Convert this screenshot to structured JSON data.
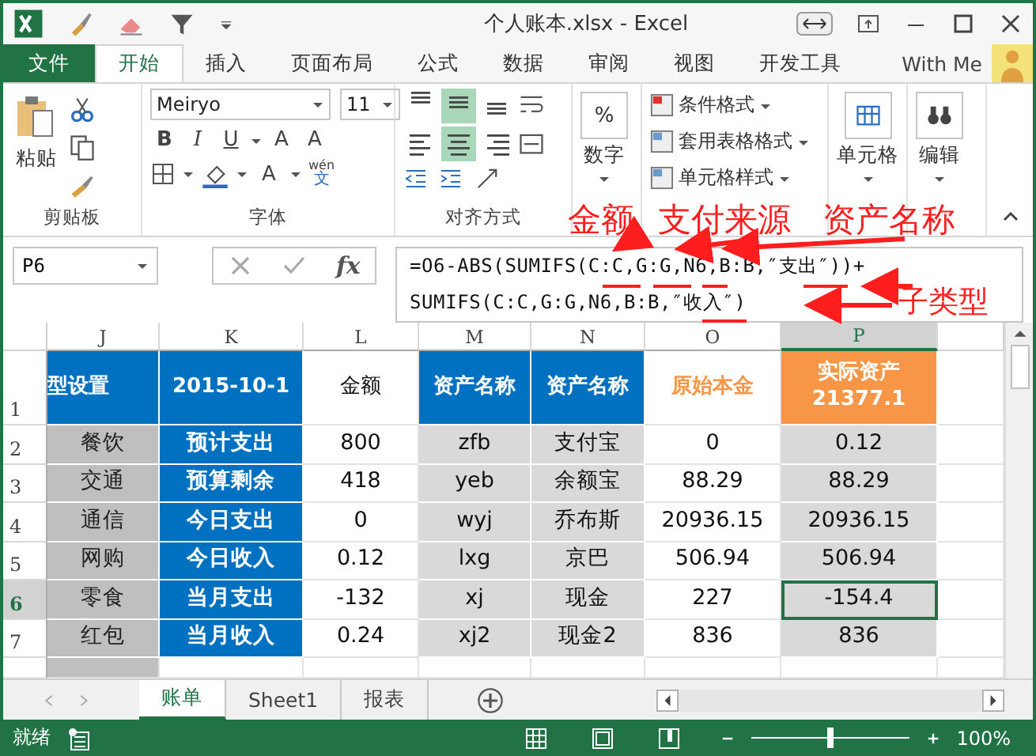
{
  "title_bar": {
    "title": "个人账本.xlsx - Excel"
  },
  "ribbon_tabs": [
    {
      "label": "文件",
      "kind": "file",
      "selected": false
    },
    {
      "label": "开始",
      "kind": "tab",
      "selected": true
    },
    {
      "label": "插入",
      "kind": "tab",
      "selected": false
    },
    {
      "label": "页面布局",
      "kind": "tab",
      "selected": false
    },
    {
      "label": "公式",
      "kind": "tab",
      "selected": false
    },
    {
      "label": "数据",
      "kind": "tab",
      "selected": false
    },
    {
      "label": "审阅",
      "kind": "tab",
      "selected": false
    },
    {
      "label": "视图",
      "kind": "tab",
      "selected": false
    },
    {
      "label": "开发工具",
      "kind": "tab",
      "selected": false
    }
  ],
  "account": {
    "name": "With Me"
  },
  "ribbon": {
    "clipboard": {
      "paste": "粘贴",
      "label": "剪贴板"
    },
    "font": {
      "font_name": "Meiryo",
      "font_size": "11",
      "bold": "B",
      "italic": "I",
      "underline": "U",
      "grow": "A",
      "shrink": "A",
      "font_color": "A",
      "phonetic_top": "wén",
      "phonetic_bottom": "文",
      "label": "字体"
    },
    "alignment": {
      "label": "对齐方式",
      "buttons": [
        {
          "kind": "top",
          "selected": false
        },
        {
          "kind": "middle",
          "selected": true
        },
        {
          "kind": "bottom",
          "selected": false
        },
        {
          "kind": "left",
          "selected": false
        },
        {
          "kind": "center",
          "selected": true
        },
        {
          "kind": "right",
          "selected": false
        }
      ]
    },
    "number": {
      "symbol": "%",
      "label": "数字"
    },
    "styles": {
      "items": [
        "条件格式",
        "套用表格格式",
        "单元格样式"
      ]
    },
    "cells": {
      "label": "单元格"
    },
    "editing": {
      "label": "编辑"
    }
  },
  "formula_bar": {
    "name_box": "P6",
    "fx": "fx",
    "formula_lines": [
      "=O6-ABS(SUMIFS(C:C,G:G,N6,B:B,″支出″))+",
      "SUMIFS(C:C,G:G,N6,B:B,″收入″)"
    ]
  },
  "annotations": [
    "金额",
    "支付来源",
    "资产名称",
    "子类型"
  ],
  "sheet": {
    "columns": [
      {
        "letter": "J",
        "kind": "grey",
        "selected": false
      },
      {
        "letter": "K",
        "kind": "blue",
        "selected": false
      },
      {
        "letter": "L",
        "kind": "plain",
        "selected": false
      },
      {
        "letter": "M",
        "kind": "light",
        "selected": false
      },
      {
        "letter": "N",
        "kind": "light",
        "selected": false
      },
      {
        "letter": "O",
        "kind": "plain",
        "selected": false
      },
      {
        "letter": "P",
        "kind": "light",
        "selected": true
      }
    ],
    "header_row": {
      "number": "1",
      "selected": false,
      "cells": [
        {
          "text": "型设置",
          "kind": "blue"
        },
        {
          "text": "2015-10-1",
          "kind": "blue"
        },
        {
          "text": "金额",
          "kind": "plain"
        },
        {
          "text": "资产名称",
          "kind": "blue"
        },
        {
          "text": "资产名称",
          "kind": "blue"
        },
        {
          "text": "原始本金",
          "kind": "orange_text"
        },
        {
          "text": "实际资产\n21377.1",
          "kind": "orange"
        }
      ]
    },
    "rows": [
      {
        "number": "2",
        "selected": false,
        "cells": [
          "餐饮",
          "预计支出",
          "800",
          "zfb",
          "支付宝",
          "0",
          "0.12"
        ]
      },
      {
        "number": "3",
        "selected": false,
        "cells": [
          "交通",
          "预算剩余",
          "418",
          "yeb",
          "余额宝",
          "88.29",
          "88.29"
        ]
      },
      {
        "number": "4",
        "selected": false,
        "cells": [
          "通信",
          "今日支出",
          "0",
          "wyj",
          "乔布斯",
          "20936.15",
          "20936.15"
        ]
      },
      {
        "number": "5",
        "selected": false,
        "cells": [
          "网购",
          "今日收入",
          "0.12",
          "lxg",
          "京巴",
          "506.94",
          "506.94"
        ]
      },
      {
        "number": "6",
        "selected": true,
        "cells": [
          "零食",
          "当月支出",
          "-132",
          "xj",
          "现金",
          "227",
          "-154.4"
        ]
      },
      {
        "number": "7",
        "selected": false,
        "cells": [
          "红包",
          "当月收入",
          "0.24",
          "xj2",
          "现金2",
          "836",
          "836"
        ]
      }
    ]
  },
  "sheet_tabs": [
    {
      "label": "账单",
      "selected": true
    },
    {
      "label": "Sheet1",
      "selected": false
    },
    {
      "label": "报表",
      "selected": false
    }
  ],
  "status_bar": {
    "status": "就绪",
    "zoom": "100%",
    "zoom_slider": {
      "level": 0.5
    }
  }
}
